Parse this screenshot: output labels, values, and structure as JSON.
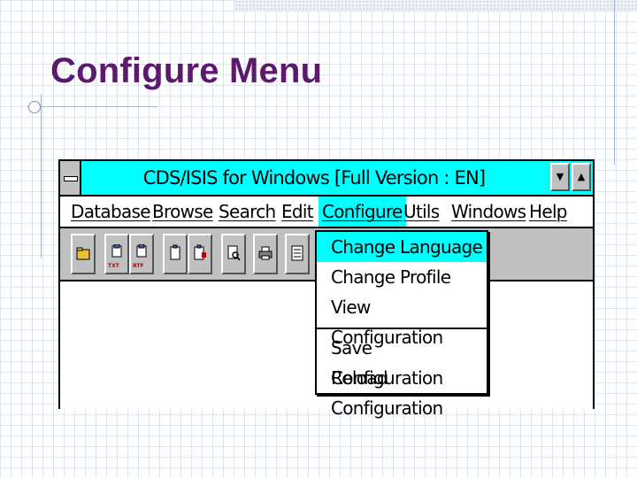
{
  "slide": {
    "title": "Configure Menu"
  },
  "window": {
    "title": "CDS/ISIS for Windows [Full Version : EN]",
    "system_menu_icon": "dash-icon",
    "scroll_down_glyph": "▼",
    "scroll_up_glyph": "▲"
  },
  "menu": {
    "items": [
      {
        "label": "Database",
        "active": false
      },
      {
        "label": "Browse",
        "active": false
      },
      {
        "label": "Search",
        "active": false
      },
      {
        "label": "Edit",
        "active": false
      },
      {
        "label": "Configure",
        "active": true
      },
      {
        "label": "Utils",
        "active": false
      },
      {
        "label": "Windows",
        "active": false
      },
      {
        "label": "Help",
        "active": false
      }
    ]
  },
  "toolbar": {
    "buttons": [
      {
        "icon": "open-folder-icon",
        "label": ""
      },
      {
        "icon": "export-txt-icon",
        "label": "TXT"
      },
      {
        "icon": "export-rtf-icon",
        "label": "RTF"
      },
      {
        "icon": "clipboard-icon",
        "label": ""
      },
      {
        "icon": "clipboard-paste-icon",
        "label": ""
      },
      {
        "icon": "search-document-icon",
        "label": ""
      },
      {
        "icon": "printer-icon",
        "label": ""
      },
      {
        "icon": "list-icon",
        "label": ""
      }
    ]
  },
  "configure_menu": {
    "group1": [
      "Change Language",
      "Change Profile",
      "View Configuration"
    ],
    "group2": [
      "Save Configuration",
      "Reload Configuration"
    ],
    "highlighted": "Change Language"
  },
  "colors": {
    "title_color": "#5b1a6b",
    "window_accent": "#00ffff",
    "toolbar_bg": "#c0c0c0"
  }
}
